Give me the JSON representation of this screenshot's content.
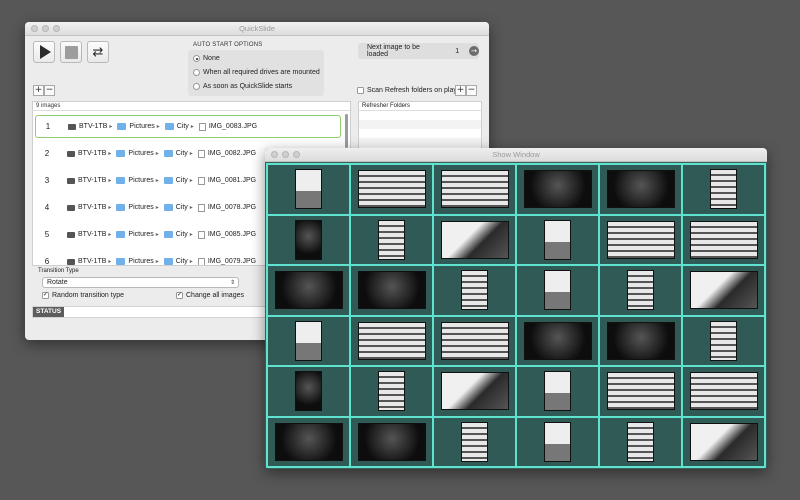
{
  "main_window": {
    "title": "QuickSlide",
    "auto_start": {
      "title": "AUTO START OPTIONS",
      "options": [
        {
          "label": "None",
          "selected": true
        },
        {
          "label": "When all required drives are mounted",
          "selected": false
        },
        {
          "label": "As soon as QuickSlide starts",
          "selected": false
        }
      ]
    },
    "next_image": {
      "label": "Next image to be loaded",
      "value": "1"
    },
    "list_buttons": {
      "add": "+",
      "remove": "−"
    },
    "scan_refresh": {
      "label": "Scan Refresh folders on play",
      "checked": false
    },
    "image_list": {
      "count_label": "9 images",
      "rows": [
        {
          "index": "1",
          "drive": "BTV-1TB",
          "folder1": "Pictures",
          "folder2": "City",
          "file": "IMG_0083.JPG"
        },
        {
          "index": "2",
          "drive": "BTV-1TB",
          "folder1": "Pictures",
          "folder2": "City",
          "file": "IMG_0082.JPG"
        },
        {
          "index": "3",
          "drive": "BTV-1TB",
          "folder1": "Pictures",
          "folder2": "City",
          "file": "IMG_0081.JPG"
        },
        {
          "index": "4",
          "drive": "BTV-1TB",
          "folder1": "Pictures",
          "folder2": "City",
          "file": "IMG_0078.JPG"
        },
        {
          "index": "5",
          "drive": "BTV-1TB",
          "folder1": "Pictures",
          "folder2": "City",
          "file": "IMG_0085.JPG"
        },
        {
          "index": "6",
          "drive": "BTV-1TB",
          "folder1": "Pictures",
          "folder2": "City",
          "file": "IMG_0079.JPG"
        }
      ]
    },
    "refresher": {
      "header": "Refresher Folders"
    },
    "transition": {
      "label": "Transition Type",
      "value": "Rotate",
      "random_label": "Random transition type",
      "random_checked": true,
      "change_all_label": "Change all images",
      "change_all_checked": true
    },
    "status": {
      "badge": "STATUS",
      "text": ""
    }
  },
  "show_window": {
    "title": "Show Window",
    "grid": [
      [
        "church",
        "building",
        "building",
        "dark",
        "dark",
        "building-p"
      ],
      [
        "tree",
        "building-p",
        "sky",
        "church",
        "building",
        "building"
      ],
      [
        "dark",
        "dark",
        "building-p",
        "church",
        "building-p",
        "sky"
      ],
      [
        "church",
        "building",
        "building",
        "dark",
        "dark",
        "building-p"
      ],
      [
        "tree",
        "building-p",
        "sky",
        "church",
        "building",
        "building"
      ],
      [
        "dark",
        "dark",
        "building-p",
        "church",
        "building-p",
        "sky"
      ]
    ]
  },
  "colors": {
    "grid_border": "#5fe3cf",
    "show_bg": "#2f5a55",
    "selected_row": "#8fcf6f"
  }
}
